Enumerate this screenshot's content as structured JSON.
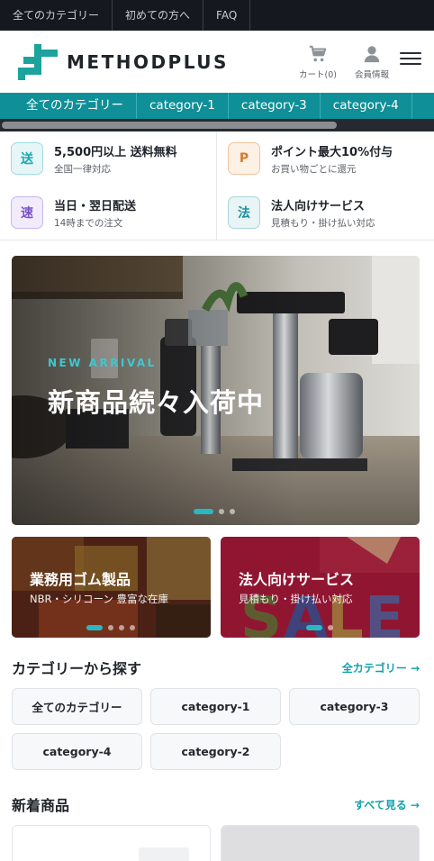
{
  "utility_nav": {
    "links": [
      "全てのカテゴリー",
      "初めての方へ",
      "FAQ"
    ]
  },
  "header": {
    "brand": "METHODPLUS",
    "cart_label": "カート(0)",
    "member_label": "会員情報",
    "icons": {
      "cart": "cart-icon",
      "member": "user-icon",
      "menu": "hamburger-menu-icon"
    }
  },
  "category_tabs": [
    "全てのカテゴリー",
    "category-1",
    "category-3",
    "category-4"
  ],
  "features": [
    {
      "badge": "送",
      "title": "5,500円以上 送料無料",
      "subtitle": "全国一律対応",
      "color": "#1aa8b2"
    },
    {
      "badge": "P",
      "title": "ポイント最大10%付与",
      "subtitle": "お買い物ごとに還元",
      "color": "#d9792a"
    },
    {
      "badge": "速",
      "title": "当日・翌日配送",
      "subtitle": "14時までの注文",
      "color": "#7a52c7"
    },
    {
      "badge": "法",
      "title": "法人向けサービス",
      "subtitle": "見積もり・掛け払い対応",
      "color": "#1a8f99"
    }
  ],
  "hero": {
    "kicker": "NEW ARRIVAL",
    "title": "新商品続々入荷中",
    "slide_count": 3,
    "active_slide": 1
  },
  "promos": [
    {
      "title": "業務用ゴム製品",
      "subtitle": "NBR・シリコーン 豊富な在庫",
      "slide_count": 4,
      "active_slide": 1
    },
    {
      "title": "法人向けサービス",
      "subtitle": "見積もり・掛け払い対応",
      "slide_count": 2,
      "active_slide": 1
    }
  ],
  "category_section": {
    "title": "カテゴリーから探す",
    "link": "全カテゴリー →",
    "chips": [
      "全てのカテゴリー",
      "category-1",
      "category-3",
      "category-4",
      "category-2"
    ]
  },
  "new_products_section": {
    "title": "新着商品",
    "link": "すべて見る →"
  },
  "colors": {
    "accent": "#0f8f97",
    "link": "#12a0aa",
    "dark_bar": "#15191f"
  }
}
